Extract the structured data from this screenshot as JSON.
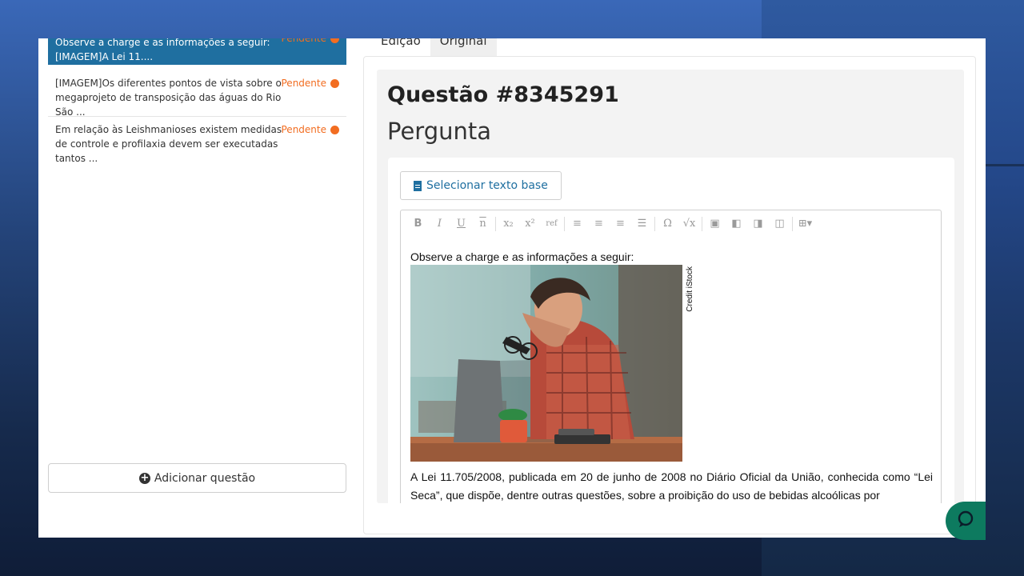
{
  "questions": [
    {
      "text": "Observe a charge e as informações a seguir: [IMAGEM]A Lei 11....",
      "status": "Pendente"
    },
    {
      "text": "[IMAGEM]Os diferentes pontos de vista sobre o megaprojeto de transposição das águas do Rio São ...",
      "status": "Pendente"
    },
    {
      "text": "Em relação às Leishmanioses existem medidas de controle e profilaxia devem ser executadas tantos ...",
      "status": "Pendente"
    }
  ],
  "add_button": "Adicionar questão",
  "tabs": [
    "Edição",
    "Original"
  ],
  "question_title": "Questão #8345291",
  "section_title": "Pergunta",
  "select_base_button": "Selecionar texto base",
  "toolbar_icons": [
    "bold-icon",
    "italic-icon",
    "underline-icon",
    "overline-icon",
    "subscript-icon",
    "superscript-icon",
    "ref-icon",
    "align-left-icon",
    "align-center-icon",
    "align-right-icon",
    "justify-icon",
    "omega-icon",
    "sqrt-icon",
    "image-icon",
    "image-left-icon",
    "image-right-icon",
    "image-center-icon",
    "table-icon"
  ],
  "editor": {
    "intro": "Observe a charge e as informações a seguir:",
    "image_credit": "Credit iStock",
    "paragraph": "A Lei 11.705/2008, publicada em 20 de junho de 2008 no Diário Oficial da União, conhecida como “Lei Seca”, que dispõe, dentre outras questões, sobre a proibição do uso de bebidas alcoólicas por"
  },
  "colors": {
    "accent": "#1f6fa0",
    "status": "#f26d21",
    "chat": "#0d7a5f"
  }
}
